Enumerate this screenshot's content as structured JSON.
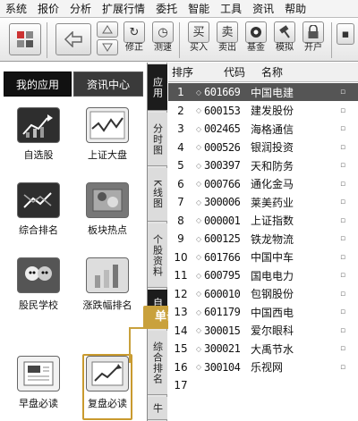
{
  "menu": [
    "系统",
    "报价",
    "分析",
    "扩展行情",
    "委托",
    "智能",
    "工具",
    "资讯",
    "帮助"
  ],
  "toolbar": {
    "buttons": [
      {
        "label": "",
        "icon": "grid-icon"
      },
      {
        "label": "",
        "icon": "back-arrow-icon"
      },
      {
        "label": "",
        "icon": "up-arrow-icon"
      },
      {
        "label": "修正",
        "icon": "refresh-icon"
      },
      {
        "label": "测速",
        "icon": "clock-icon"
      },
      {
        "label": "买入",
        "glyph": "买"
      },
      {
        "label": "卖出",
        "glyph": "卖"
      },
      {
        "label": "基金",
        "icon": "fund-icon"
      },
      {
        "label": "模拟",
        "icon": "hammer-icon"
      },
      {
        "label": "开户",
        "icon": "lock-icon"
      }
    ]
  },
  "left_panel": {
    "tabs": [
      "我的应用",
      "资讯中心"
    ],
    "apps": [
      {
        "label": "自选股",
        "icon": "stock-pick-icon"
      },
      {
        "label": "上证大盘",
        "icon": "index-chart-icon"
      },
      {
        "label": "综合排名",
        "icon": "ranking-icon"
      },
      {
        "label": "板块热点",
        "icon": "sector-hot-icon"
      },
      {
        "label": "股民学校",
        "icon": "school-icon"
      },
      {
        "label": "涨跌幅排名",
        "icon": "bar-rank-icon"
      },
      {
        "label": "早盘必读",
        "icon": "newspaper-icon"
      },
      {
        "label": "复盘必读",
        "icon": "review-chart-icon"
      }
    ]
  },
  "vertical_tabs": [
    "应用",
    "分时图",
    "K线图",
    "个股资料",
    "自选",
    "综合排名",
    "牛"
  ],
  "callout": {
    "text": "单击"
  },
  "table": {
    "headers": {
      "index": "排序",
      "code": "代码",
      "name": "名称"
    },
    "rows": [
      {
        "n": "1",
        "code": "601669",
        "name": "中国电建"
      },
      {
        "n": "2",
        "code": "600153",
        "name": "建发股份"
      },
      {
        "n": "3",
        "code": "002465",
        "name": "海格通信"
      },
      {
        "n": "4",
        "code": "000526",
        "name": "银润投资"
      },
      {
        "n": "5",
        "code": "300397",
        "name": "天和防务"
      },
      {
        "n": "6",
        "code": "000766",
        "name": "通化金马"
      },
      {
        "n": "7",
        "code": "300006",
        "name": "莱美药业"
      },
      {
        "n": "8",
        "code": "000001",
        "name": "上证指数"
      },
      {
        "n": "9",
        "code": "600125",
        "name": "铁龙物流"
      },
      {
        "n": "10",
        "code": "601766",
        "name": "中国中车"
      },
      {
        "n": "11",
        "code": "600795",
        "name": "国电电力"
      },
      {
        "n": "12",
        "code": "600010",
        "name": "包钢股份"
      },
      {
        "n": "13",
        "code": "601179",
        "name": "中国西电"
      },
      {
        "n": "14",
        "code": "300015",
        "name": "爱尔眼科"
      },
      {
        "n": "15",
        "code": "300021",
        "name": "大禹节水"
      },
      {
        "n": "16",
        "code": "300104",
        "name": "乐视网"
      },
      {
        "n": "17",
        "code": "",
        "name": ""
      }
    ]
  }
}
